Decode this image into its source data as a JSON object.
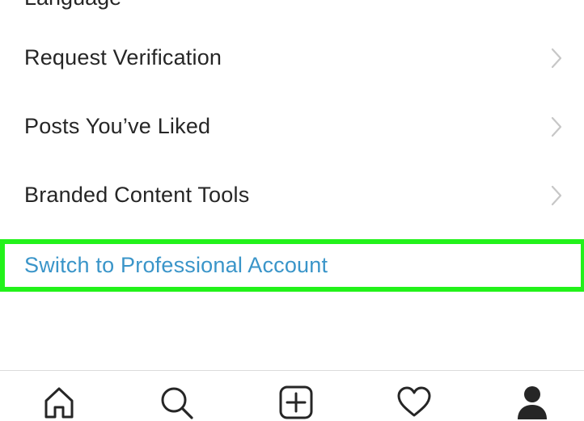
{
  "settings_list": {
    "clipped_item_label": "Language",
    "items": [
      {
        "label": "Request Verification"
      },
      {
        "label": "Posts You’ve Liked"
      },
      {
        "label": "Branded Content Tools"
      }
    ],
    "switch_account_label": "Switch to Professional Account"
  },
  "colors": {
    "text_primary": "#262626",
    "link_blue": "#3a95c9",
    "highlight_green": "#22f21a",
    "chevron_gray": "#c7c7c7",
    "divider": "#dbdbdb"
  },
  "tab_bar": {
    "tabs": [
      {
        "icon": "home-icon"
      },
      {
        "icon": "search-icon"
      },
      {
        "icon": "new-post-icon"
      },
      {
        "icon": "heart-icon"
      },
      {
        "icon": "profile-icon"
      }
    ]
  }
}
